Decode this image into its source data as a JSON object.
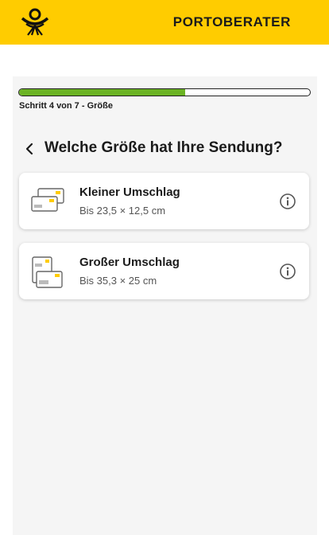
{
  "header": {
    "logo_icon": "posthorn-logo-icon",
    "title": "PORTOBERATER",
    "background": "#ffcc00"
  },
  "progress": {
    "current_step": 4,
    "total_steps": 7,
    "fraction": 0.57,
    "label": "Schritt 4 von 7 - Größe",
    "fill_color": "#6bb324"
  },
  "question": {
    "back_icon": "chevron-left-icon",
    "text": "Welche Größe hat Ihre Sendung?"
  },
  "options": [
    {
      "icon": "small-envelope-icon",
      "title": "Kleiner Umschlag",
      "subtitle": "Bis 23,5 × 12,5 cm",
      "info_icon": "info-icon"
    },
    {
      "icon": "large-envelope-icon",
      "title": "Großer Umschlag",
      "subtitle": "Bis 35,3 × 25 cm",
      "info_icon": "info-icon"
    }
  ]
}
